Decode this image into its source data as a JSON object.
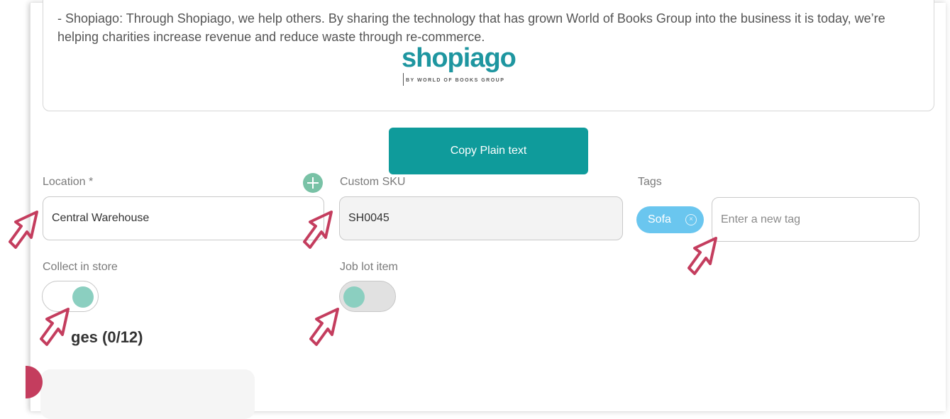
{
  "description": {
    "text": "- Shopiago: Through Shopiago, we help others. By sharing the technology that has grown World of Books Group into the business it is today, we’re helping charities increase revenue and reduce waste through re-commerce.",
    "logo_word": "shopiago",
    "logo_sub": "BY WORLD OF BOOKS GROUP"
  },
  "copy_button": {
    "label": "Copy Plain text"
  },
  "location": {
    "label": "Location *",
    "value": "Central Warehouse"
  },
  "custom_sku": {
    "label": "Custom SKU",
    "value": "SH0045"
  },
  "tags": {
    "label": "Tags",
    "chips": [
      "Sofa"
    ],
    "placeholder": "Enter a new tag"
  },
  "collect_in_store": {
    "label": "Collect in store",
    "state": "on"
  },
  "job_lot_item": {
    "label": "Job lot item",
    "state": "off"
  },
  "images_section": {
    "heading": "ges (0/12)"
  },
  "colors": {
    "accent": "#0f9b9b",
    "toggle_knob": "#8bcfc0",
    "tag_chip": "#6ac6ef",
    "cursor_outline": "#c43d5e"
  },
  "icons": [
    "plus-icon",
    "tag-remove-icon",
    "pointer-cursor-icon"
  ]
}
